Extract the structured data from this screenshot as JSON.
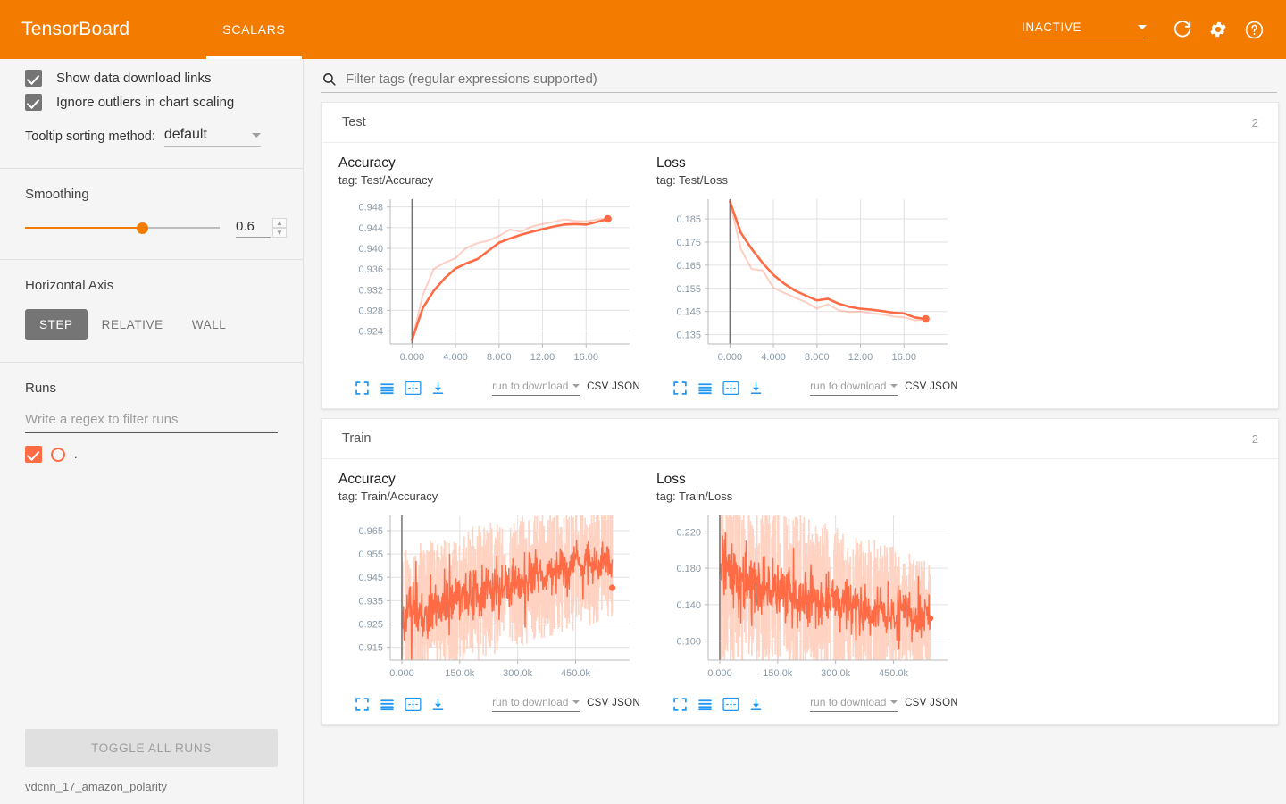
{
  "header": {
    "brand": "TensorBoard",
    "tabs": [
      {
        "label": "SCALARS",
        "active": true
      }
    ],
    "status_value": "INACTIVE",
    "icons": [
      "refresh-icon",
      "settings-icon",
      "help-icon"
    ]
  },
  "sidebar": {
    "checkboxes": [
      {
        "label": "Show data download links",
        "checked": true
      },
      {
        "label": "Ignore outliers in chart scaling",
        "checked": true
      }
    ],
    "tooltip_sorting": {
      "label": "Tooltip sorting method:",
      "value": "default"
    },
    "smoothing": {
      "title": "Smoothing",
      "value": "0.6",
      "fraction": 0.6
    },
    "horizontal_axis": {
      "title": "Horizontal Axis",
      "options": [
        "STEP",
        "RELATIVE",
        "WALL"
      ],
      "selected": "STEP"
    },
    "runs": {
      "title": "Runs",
      "filter_placeholder": "Write a regex to filter runs",
      "items": [
        {
          "name": ".",
          "checked": true,
          "color": "#ff6b45"
        }
      ],
      "toggle_all_label": "TOGGLE ALL RUNS",
      "logdir": "vdcnn_17_amazon_polarity"
    }
  },
  "main": {
    "filter_placeholder": "Filter tags (regular expressions supported)",
    "download": {
      "placeholder": "run to download",
      "csv": "CSV",
      "json": "JSON"
    },
    "tool_icons": [
      "fullscreen-icon",
      "log-scale-icon",
      "data-fit-icon",
      "download-icon"
    ],
    "sections": [
      {
        "title": "Test",
        "count": "2"
      },
      {
        "title": "Train",
        "count": "2"
      }
    ]
  },
  "colors": {
    "header_orange": "#f37c00",
    "series_orange": "#ff6b45",
    "series_faded": "#ffd2c2",
    "tool_blue": "#2196f3"
  },
  "chart_data": [
    {
      "type": "line",
      "title": "Accuracy",
      "tag": "tag: Test/Accuracy",
      "section": "Test",
      "xlabel": "",
      "ylabel": "",
      "xticks": [
        "0.000",
        "4.000",
        "8.000",
        "12.00",
        "16.00"
      ],
      "xtickvals": [
        0,
        4,
        8,
        12,
        16
      ],
      "yticks": [
        "0.924",
        "0.928",
        "0.932",
        "0.936",
        "0.940",
        "0.944",
        "0.948"
      ],
      "ytickvals": [
        0.924,
        0.928,
        0.932,
        0.936,
        0.94,
        0.944,
        0.948
      ],
      "xlim": [
        -2,
        20
      ],
      "ylim": [
        0.9215,
        0.9495
      ],
      "grid": true,
      "legend": "none",
      "series": [
        {
          "name": "smoothed",
          "opacity": 1,
          "x": [
            0,
            1,
            2,
            3,
            4,
            5,
            6,
            7,
            8,
            9,
            10,
            11,
            12,
            13,
            14,
            15,
            16,
            17,
            18
          ],
          "y": [
            0.9223,
            0.9285,
            0.9318,
            0.9342,
            0.9361,
            0.9371,
            0.9379,
            0.9395,
            0.9411,
            0.9419,
            0.9426,
            0.9432,
            0.9437,
            0.9442,
            0.9446,
            0.9447,
            0.9446,
            0.9451,
            0.9457
          ]
        },
        {
          "name": "raw",
          "opacity": 0.32,
          "x": [
            0,
            1,
            2,
            3,
            4,
            5,
            6,
            7,
            8,
            9,
            10,
            11,
            12,
            13,
            14,
            15,
            16,
            17,
            18
          ],
          "y": [
            0.9223,
            0.931,
            0.936,
            0.9372,
            0.9381,
            0.9401,
            0.941,
            0.9415,
            0.9424,
            0.9436,
            0.9432,
            0.9442,
            0.9447,
            0.9451,
            0.9456,
            0.9453,
            0.9452,
            0.9456,
            0.9458
          ]
        }
      ],
      "last_point": {
        "x": 18,
        "y": 0.9457
      }
    },
    {
      "type": "line",
      "title": "Loss",
      "tag": "tag: Test/Loss",
      "section": "Test",
      "xlabel": "",
      "ylabel": "",
      "xticks": [
        "0.000",
        "4.000",
        "8.000",
        "12.00",
        "16.00"
      ],
      "xtickvals": [
        0,
        4,
        8,
        12,
        16
      ],
      "yticks": [
        "0.135",
        "0.145",
        "0.155",
        "0.165",
        "0.175",
        "0.185"
      ],
      "ytickvals": [
        0.135,
        0.145,
        0.155,
        0.165,
        0.175,
        0.185
      ],
      "xlim": [
        -2,
        20
      ],
      "ylim": [
        0.131,
        0.1935
      ],
      "grid": true,
      "legend": "none",
      "series": [
        {
          "name": "smoothed",
          "opacity": 1,
          "x": [
            0,
            1,
            2,
            3,
            4,
            5,
            6,
            7,
            8,
            9,
            10,
            11,
            12,
            13,
            14,
            15,
            16,
            17,
            18
          ],
          "y": [
            0.1925,
            0.179,
            0.172,
            0.166,
            0.1608,
            0.157,
            0.154,
            0.1518,
            0.1498,
            0.1505,
            0.1484,
            0.147,
            0.1462,
            0.1458,
            0.1452,
            0.1445,
            0.1442,
            0.1424,
            0.1418
          ]
        },
        {
          "name": "raw",
          "opacity": 0.32,
          "x": [
            0,
            1,
            2,
            3,
            4,
            5,
            6,
            7,
            8,
            9,
            10,
            11,
            12,
            13,
            14,
            15,
            16,
            17,
            18
          ],
          "y": [
            0.1925,
            0.172,
            0.1633,
            0.1628,
            0.1552,
            0.153,
            0.151,
            0.149,
            0.1463,
            0.1482,
            0.1455,
            0.1448,
            0.145,
            0.1442,
            0.1438,
            0.1428,
            0.1425,
            0.1412,
            0.1415
          ]
        }
      ],
      "last_point": {
        "x": 18,
        "y": 0.1418
      }
    },
    {
      "type": "line",
      "title": "Accuracy",
      "tag": "tag: Train/Accuracy",
      "section": "Train",
      "xlabel": "",
      "ylabel": "",
      "xticks": [
        "0.000",
        "150.0k",
        "300.0k",
        "450.0k"
      ],
      "xtickvals": [
        0,
        150000,
        300000,
        450000
      ],
      "yticks": [
        "0.915",
        "0.925",
        "0.935",
        "0.945",
        "0.955",
        "0.965"
      ],
      "ytickvals": [
        0.915,
        0.925,
        0.935,
        0.945,
        0.955,
        0.965
      ],
      "xlim": [
        -30000,
        590000
      ],
      "ylim": [
        0.9095,
        0.9715
      ],
      "grid": true,
      "legend": "none",
      "noisy": true,
      "trend": {
        "start": 0.9255,
        "end": 0.9525,
        "amplitude_start": 0.0125,
        "amplitude_end": 0.0105
      },
      "last_point": {
        "x": 545000,
        "y": 0.9405
      }
    },
    {
      "type": "line",
      "title": "Loss",
      "tag": "tag: Train/Loss",
      "section": "Train",
      "xlabel": "",
      "ylabel": "",
      "xticks": [
        "0.000",
        "150.0k",
        "300.0k",
        "450.0k"
      ],
      "xtickvals": [
        0,
        150000,
        300000,
        450000
      ],
      "yticks": [
        "0.100",
        "0.140",
        "0.180",
        "0.220"
      ],
      "ytickvals": [
        0.1,
        0.14,
        0.18,
        0.22
      ],
      "xlim": [
        -30000,
        590000
      ],
      "ylim": [
        0.079,
        0.238
      ],
      "grid": true,
      "legend": "none",
      "noisy": true,
      "trend": {
        "start": 0.176,
        "end": 0.125,
        "amplitude_start": 0.042,
        "amplitude_end": 0.027
      },
      "last_point": {
        "x": 545000,
        "y": 0.125
      }
    }
  ]
}
